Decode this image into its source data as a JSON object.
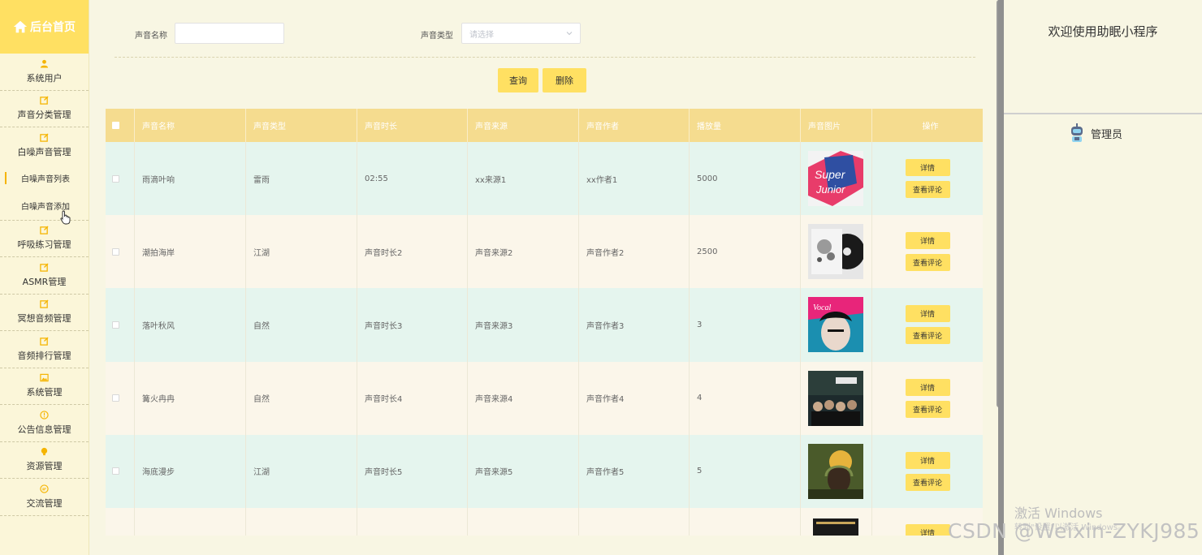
{
  "sidebar": {
    "title": "后台首页",
    "items": [
      {
        "label": "系统用户",
        "icon": "user-icon"
      },
      {
        "label": "声音分类管理",
        "icon": "edit-icon"
      },
      {
        "label": "白噪声音管理",
        "icon": "edit-icon"
      },
      {
        "label": "呼吸练习管理",
        "icon": "edit-icon"
      },
      {
        "label": "ASMR管理",
        "icon": "edit-icon"
      },
      {
        "label": "冥想音频管理",
        "icon": "edit-icon"
      },
      {
        "label": "音频排行管理",
        "icon": "edit-icon"
      },
      {
        "label": "系统管理",
        "icon": "image-icon"
      },
      {
        "label": "公告信息管理",
        "icon": "info-circle-icon"
      },
      {
        "label": "资源管理",
        "icon": "bulb-icon"
      },
      {
        "label": "交流管理",
        "icon": "chat-icon"
      }
    ],
    "submenu": [
      {
        "label": "白噪声音列表",
        "active": true
      },
      {
        "label": "白噪声音添加",
        "active": false
      }
    ]
  },
  "search": {
    "name_label": "声音名称",
    "name_value": "",
    "type_label": "声音类型",
    "type_placeholder": "请选择",
    "query_button": "查询",
    "delete_button": "删除"
  },
  "table": {
    "headers": [
      "声音名称",
      "声音类型",
      "声音时长",
      "声音来源",
      "声音作者",
      "播放量",
      "声音图片",
      "操作"
    ],
    "rows": [
      {
        "name": "雨滴叶响",
        "type": "雷雨",
        "duration": "02:55",
        "source": "xx来源1",
        "author": "xx作者1",
        "plays": "5000",
        "cover": "album-cover-super-junior"
      },
      {
        "name": "潮拍海岸",
        "type": "江湖",
        "duration": "声音时长2",
        "source": "声音来源2",
        "author": "声音作者2",
        "plays": "2500",
        "cover": "album-cover-vinyl"
      },
      {
        "name": "落叶秋风",
        "type": "自然",
        "duration": "声音时长3",
        "source": "声音来源3",
        "author": "声音作者3",
        "plays": "3",
        "cover": "album-cover-portrait"
      },
      {
        "name": "篝火冉冉",
        "type": "自然",
        "duration": "声音时长4",
        "source": "声音来源4",
        "author": "声音作者4",
        "plays": "4",
        "cover": "album-cover-group"
      },
      {
        "name": "海底漫步",
        "type": "江湖",
        "duration": "声音时长5",
        "source": "声音来源5",
        "author": "声音作者5",
        "plays": "5",
        "cover": "album-cover-headphones"
      },
      {
        "name": "",
        "type": "",
        "duration": "",
        "source": "",
        "author": "",
        "plays": "",
        "cover": "album-cover-dark"
      }
    ],
    "detail_button": "详情",
    "comment_button": "查看评论"
  },
  "right_panel": {
    "welcome": "欢迎使用助眠小程序",
    "role": "管理员"
  },
  "watermarks": {
    "activate_title": "激活 Windows",
    "activate_sub": "转到\"设置\"以激活 Windows。",
    "csdn": "CSDN @Weixin-ZYKJ985"
  },
  "colors": {
    "accent": "#ffe062",
    "header": "#f5dc8f",
    "row_mint": "#e5f5ee",
    "row_cream": "#fbf6ea"
  }
}
